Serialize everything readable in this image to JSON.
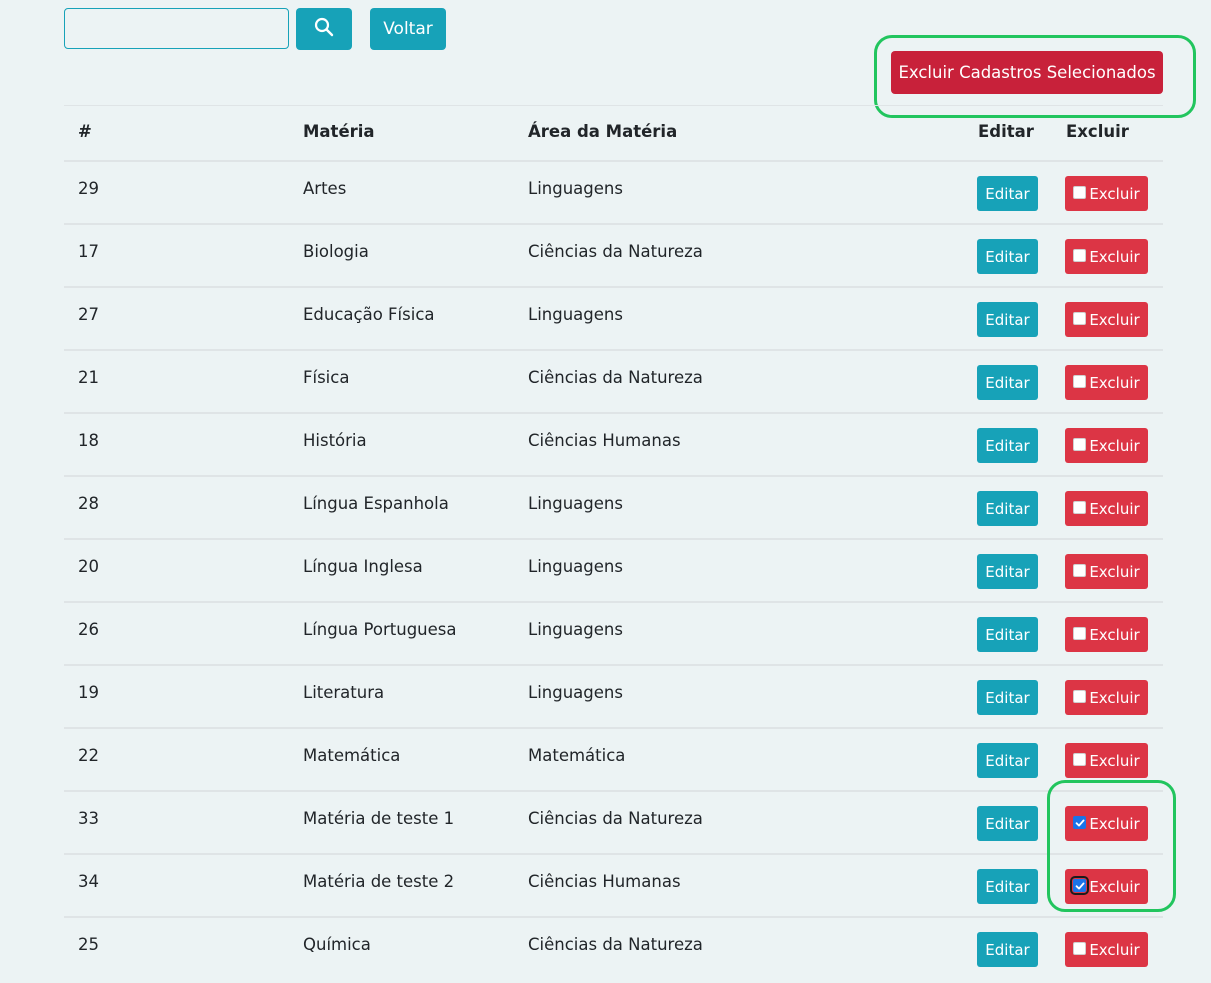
{
  "toolbar": {
    "search_value": "",
    "search_icon": "magnifier-icon",
    "back_label": "Voltar",
    "bulk_delete_label": "Excluir Cadastros Selecionados"
  },
  "table": {
    "headers": {
      "id": "#",
      "subject": "Matéria",
      "area": "Área da Matéria",
      "edit": "Editar",
      "delete": "Excluir"
    },
    "rows": [
      {
        "id": "29",
        "subject": "Artes",
        "area": "Linguagens",
        "edit_label": "Editar",
        "delete_label": "Excluir",
        "selected": false
      },
      {
        "id": "17",
        "subject": "Biologia",
        "area": "Ciências da Natureza",
        "edit_label": "Editar",
        "delete_label": "Excluir",
        "selected": false
      },
      {
        "id": "27",
        "subject": "Educação Física",
        "area": "Linguagens",
        "edit_label": "Editar",
        "delete_label": "Excluir",
        "selected": false
      },
      {
        "id": "21",
        "subject": "Física",
        "area": "Ciências da Natureza",
        "edit_label": "Editar",
        "delete_label": "Excluir",
        "selected": false
      },
      {
        "id": "18",
        "subject": "História",
        "area": "Ciências Humanas",
        "edit_label": "Editar",
        "delete_label": "Excluir",
        "selected": false
      },
      {
        "id": "28",
        "subject": "Língua Espanhola",
        "area": "Linguagens",
        "edit_label": "Editar",
        "delete_label": "Excluir",
        "selected": false
      },
      {
        "id": "20",
        "subject": "Língua Inglesa",
        "area": "Linguagens",
        "edit_label": "Editar",
        "delete_label": "Excluir",
        "selected": false
      },
      {
        "id": "26",
        "subject": "Língua Portuguesa",
        "area": "Linguagens",
        "edit_label": "Editar",
        "delete_label": "Excluir",
        "selected": false
      },
      {
        "id": "19",
        "subject": "Literatura",
        "area": "Linguagens",
        "edit_label": "Editar",
        "delete_label": "Excluir",
        "selected": false
      },
      {
        "id": "22",
        "subject": "Matemática",
        "area": "Matemática",
        "edit_label": "Editar",
        "delete_label": "Excluir",
        "selected": false
      },
      {
        "id": "33",
        "subject": "Matéria de teste 1",
        "area": "Ciências da Natureza",
        "edit_label": "Editar",
        "delete_label": "Excluir",
        "selected": true
      },
      {
        "id": "34",
        "subject": "Matéria de teste 2",
        "area": "Ciências Humanas",
        "edit_label": "Editar",
        "delete_label": "Excluir",
        "selected": true
      },
      {
        "id": "25",
        "subject": "Química",
        "area": "Ciências da Natureza",
        "edit_label": "Editar",
        "delete_label": "Excluir",
        "selected": false
      }
    ]
  },
  "colors": {
    "background": "#ecf3f4",
    "info": "#17a2b8",
    "danger": "#dc3545",
    "danger_dark": "#c8213a",
    "highlight": "#22c55e",
    "checkbox_checked": "#1a73e8"
  }
}
